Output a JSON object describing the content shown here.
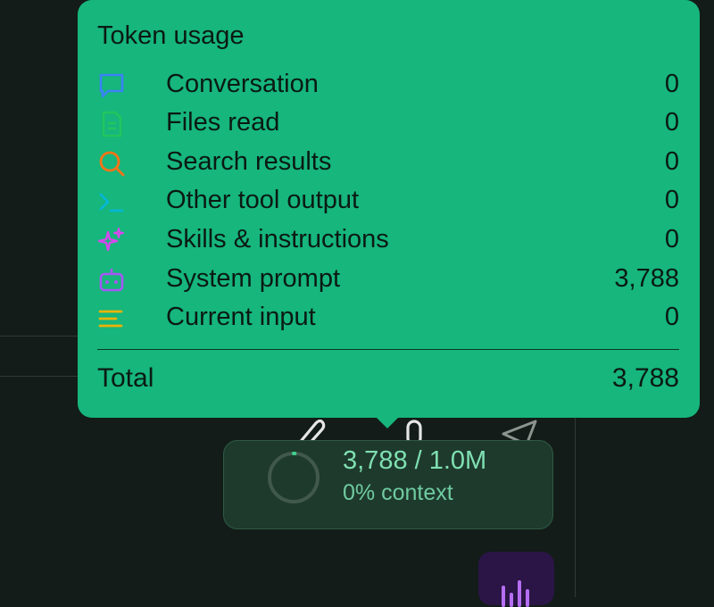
{
  "tooltip": {
    "title": "Token usage",
    "rows": [
      {
        "label": "Conversation",
        "value": "0",
        "icon": "chat-bubble-icon",
        "color": "#3b82f6"
      },
      {
        "label": "Files read",
        "value": "0",
        "icon": "file-icon",
        "color": "#22c55e"
      },
      {
        "label": "Search results",
        "value": "0",
        "icon": "search-icon",
        "color": "#f97316"
      },
      {
        "label": "Other tool output",
        "value": "0",
        "icon": "terminal-icon",
        "color": "#06b6d4"
      },
      {
        "label": "Skills & instructions",
        "value": "0",
        "icon": "sparkle-icon",
        "color": "#d946ef"
      },
      {
        "label": "System prompt",
        "value": "3,788",
        "icon": "robot-icon",
        "color": "#a855f7"
      },
      {
        "label": "Current input",
        "value": "0",
        "icon": "lines-icon",
        "color": "#eab308"
      }
    ],
    "total_label": "Total",
    "total_value": "3,788"
  },
  "usage": {
    "main": "3,788 / 1.0M",
    "sub": "0% context",
    "context_fraction": 0.0038
  },
  "toolbar": {
    "attach_icon": "paperclip-icon",
    "mic_icon": "microphone-icon",
    "send_icon": "send-icon"
  },
  "voice": {
    "icon": "audio-bars-icon",
    "color": "#b56ef2"
  }
}
